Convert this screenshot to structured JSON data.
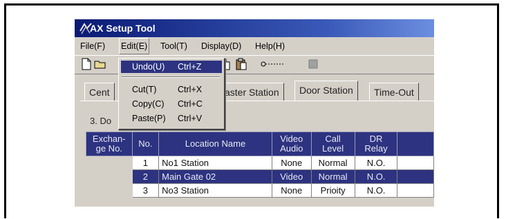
{
  "window": {
    "title": "AX Setup Tool"
  },
  "menubar": [
    "File(F)",
    "Edit(E)",
    "Tool(T)",
    "Display(D)",
    "Help(H)"
  ],
  "edit_menu": [
    {
      "label": "Undo(U)",
      "shortcut": "Ctrl+Z"
    },
    {
      "label": "Cut(T)",
      "shortcut": "Ctrl+X"
    },
    {
      "label": "Copy(C)",
      "shortcut": "Ctrl+C"
    },
    {
      "label": "Paste(P)",
      "shortcut": "Ctrl+V"
    }
  ],
  "tabs": [
    "Cent",
    "aster Station",
    "Door Station",
    "Time-Out"
  ],
  "selected_tab": "Door Station",
  "section_label": "3. Do",
  "table": {
    "headers": [
      "Exchan-\nge No.",
      "No.",
      "Location Name",
      "Video\nAudio",
      "Call\nLevel",
      "DR\nRelay"
    ],
    "rows": [
      [
        "",
        "1",
        "No1 Station",
        "None",
        "Normal",
        "N.O."
      ],
      [
        "",
        "2",
        "Main Gate 02",
        "Video",
        "Normal",
        "N.O."
      ],
      [
        "",
        "3",
        "No3 Station",
        "None",
        "Prioity",
        "N.O."
      ]
    ],
    "selected_row": 1
  },
  "colors": {
    "title_bar": "#0a1a74",
    "selection": "#2d3380",
    "face": "#d4d0c8"
  }
}
